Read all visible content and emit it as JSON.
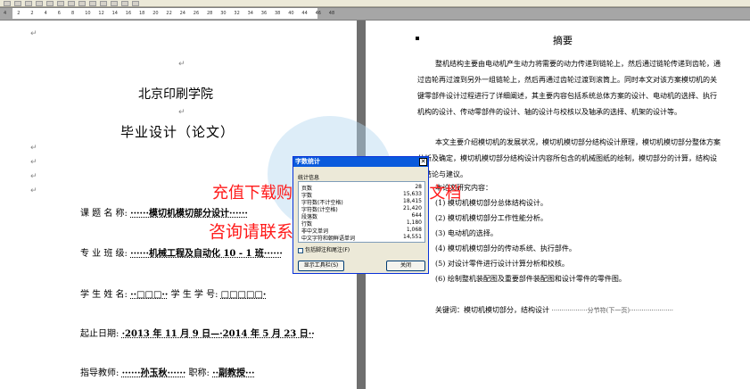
{
  "ruler": {
    "numbers": [
      "4",
      "2",
      "2",
      "4",
      "6",
      "8",
      "10",
      "12",
      "14",
      "16",
      "18",
      "20",
      "22",
      "24",
      "26",
      "28",
      "30",
      "32",
      "34",
      "36",
      "38",
      "40",
      "44",
      "46",
      "48"
    ]
  },
  "cover": {
    "school": "北京印刷学院",
    "title": "毕业设计（论文）",
    "rows": [
      {
        "label": "课 题 名 称:",
        "value": "······模切机模切部分设计······"
      },
      {
        "label": "专 业 班 级:",
        "value": "······机械工程及自动化 10 - 1 班······"
      },
      {
        "label": "学 生 姓 名:",
        "value": "··□□□··",
        "label2": "学 生 学 号:",
        "value2": "□□□□□·"
      },
      {
        "label": "起止日期:",
        "value": "·2013 年 11 月 9 日—·2014 年 5 月 23 日··"
      },
      {
        "label": "指导教师:",
        "value": "······孙玉秋······",
        "label2": "职称:",
        "value2": "··副教授···"
      }
    ]
  },
  "abstract": {
    "title": "摘要",
    "para1": "整机结构主要由电动机产生动力将需要的动力传递到链轮上，然后通过链轮传递到齿轮，通过齿轮再过渡到另外一组链轮上，然后再通过齿轮过渡到滚筒上。同时本文对该方案模切机的关键零部件设计过程进行了详细阐述，其主要内容包括系统总体方案的设计、电动机的选择、执行机构的设计、传动零部件的设计、轴的设计与校核以及轴承的选择、机架的设计等。",
    "para2": "本文主要介绍模切机的发展状况，模切机模切部分结构设计原理，模切机模切部分整体方案分析及确定，模切机模切部分结构设计内容所包含的机械图纸的绘制，模切部分的计算，结构设计结论与建议。",
    "heading": "本论文研究内容：",
    "items": [
      "(1) 模切机模切部分总体结构设计。",
      "(2) 模切机模切部分工作性能分析。",
      "(3) 电动机的选择。",
      "(4) 模切机模切部分的传动系统、执行部件。",
      "(5) 对设计零件进行设计计算分析和校核。",
      "(6) 绘制整机装配图及重要部件装配图和设计零件的零件图。"
    ],
    "keywords": "关键词：模切机模切部分，结构设计",
    "break": "分节符(下一页)"
  },
  "watermark": {
    "line1": "充值下载购买全套图纸+Word文档",
    "line2": "咨询请联系  QQ 401339828"
  },
  "dialog": {
    "title": "字数统计",
    "section": "统计信息",
    "stats": [
      {
        "label": "页数",
        "value": "28"
      },
      {
        "label": "字数",
        "value": "15,633"
      },
      {
        "label": "字符数(不计空格)",
        "value": "18,415"
      },
      {
        "label": "字符数(计空格)",
        "value": "21,420"
      },
      {
        "label": "段落数",
        "value": "644"
      },
      {
        "label": "行数",
        "value": "1,180"
      },
      {
        "label": "非中文单词",
        "value": "1,068"
      },
      {
        "label": "中文字符和朝鲜语单词",
        "value": "14,551"
      }
    ],
    "checkbox_label": "包括脚注和尾注(F)",
    "show_toolbar_button": "显示工具栏(S)",
    "close_button": "关闭"
  },
  "colors": {
    "watermark": "#ff1a1a",
    "dialog_title": "#0a5adc"
  }
}
